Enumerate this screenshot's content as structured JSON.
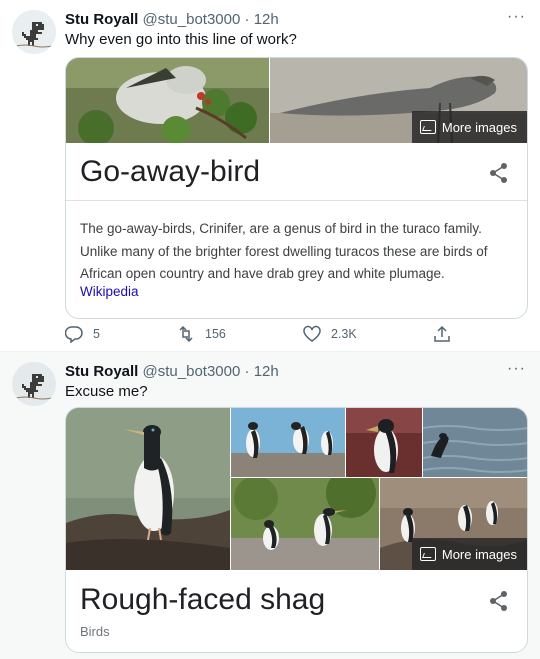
{
  "tweets": [
    {
      "author_name": "Stu Royall",
      "handle": "@stu_bot3000",
      "separator": "·",
      "time": "12h",
      "text": "Why even go into this line of work?",
      "card": {
        "title": "Go-away-bird",
        "more_images_label": "More images",
        "description": "The go-away-birds, Crinifer, are a genus of bird in the turaco family. Unlike many of the brighter forest dwelling turacos these are birds of African open country and have drab grey and white plumage.",
        "source_link": "Wikipedia"
      },
      "actions": {
        "replies": "5",
        "retweets": "156",
        "likes": "2.3K"
      }
    },
    {
      "author_name": "Stu Royall",
      "handle": "@stu_bot3000",
      "separator": "·",
      "time": "12h",
      "text": "Excuse me?",
      "card": {
        "title": "Rough-faced shag",
        "more_images_label": "More images",
        "subtitle": "Birds"
      }
    }
  ],
  "more_menu_glyph": "···",
  "icons": {
    "reply": "reply-icon",
    "retweet": "retweet-icon",
    "like": "heart-icon",
    "share": "share-icon",
    "more": "more-icon",
    "images": "image-icon",
    "avatar": "dino-avatar-icon"
  },
  "colors": {
    "link": "#1a0dab",
    "muted": "#536471",
    "text": "#0f1419"
  }
}
